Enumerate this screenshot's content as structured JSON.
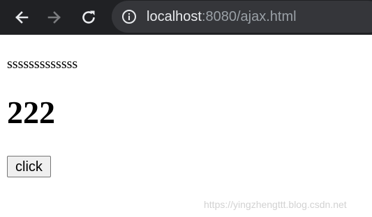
{
  "browser": {
    "url_host": "localhost",
    "url_rest": ":8080/ajax.html",
    "icons": {
      "back": "arrow-left-icon",
      "forward": "arrow-right-icon",
      "reload": "reload-icon",
      "info": "info-icon"
    }
  },
  "page": {
    "paragraph": "sssssssssssss",
    "heading": "222",
    "button_label": "click"
  },
  "watermark": "https://yingzhengttt.blog.csdn.net",
  "colors": {
    "toolbar_bg": "#202124",
    "omnibox_bg": "#35363a",
    "host_text": "#e8eaed",
    "path_text": "#9aa0a6"
  }
}
